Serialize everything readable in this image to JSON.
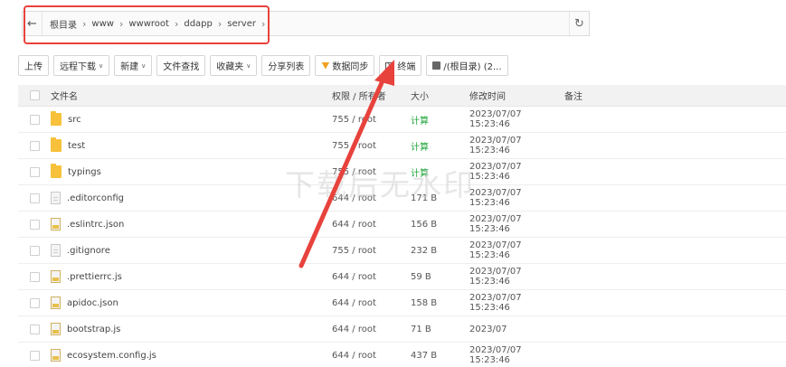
{
  "pathbar": {
    "crumbs": [
      "根目录",
      "www",
      "wwwroot",
      "ddapp",
      "server"
    ]
  },
  "toolbar": {
    "upload": "上传",
    "remote_download": "远程下载",
    "new": "新建",
    "file_search": "文件查找",
    "favorites": "收藏夹",
    "share_list": "分享列表",
    "data_sync": "数据同步",
    "terminal": "终端",
    "disk": "/(根目录) (2..."
  },
  "table": {
    "headers": {
      "name": "文件名",
      "perm": "权限 / 所有者",
      "size": "大小",
      "mtime": "修改时间",
      "note": "备注"
    },
    "rows": [
      {
        "name": "src",
        "perm": "755 / root",
        "size": "计算",
        "mtime": "2023/07/07 15:23:46"
      },
      {
        "name": "test",
        "perm": "755 / root",
        "size": "计算",
        "mtime": "2023/07/07 15:23:46"
      },
      {
        "name": "typings",
        "perm": "755 / root",
        "size": "计算",
        "mtime": "2023/07/07 15:23:46"
      },
      {
        "name": ".editorconfig",
        "perm": "644 / root",
        "size": "171 B",
        "mtime": "2023/07/07 15:23:46"
      },
      {
        "name": ".eslintrc.json",
        "perm": "644 / root",
        "size": "156 B",
        "mtime": "2023/07/07 15:23:46"
      },
      {
        "name": ".gitignore",
        "perm": "755 / root",
        "size": "232 B",
        "mtime": "2023/07/07 15:23:46"
      },
      {
        "name": ".prettierrc.js",
        "perm": "644 / root",
        "size": "59 B",
        "mtime": "2023/07/07 15:23:46"
      },
      {
        "name": "apidoc.json",
        "perm": "644 / root",
        "size": "158 B",
        "mtime": "2023/07/07 15:23:46"
      },
      {
        "name": "bootstrap.js",
        "perm": "644 / root",
        "size": "71 B",
        "mtime": "2023/07"
      },
      {
        "name": "ecosystem.config.js",
        "perm": "644 / root",
        "size": "437 B",
        "mtime": "2023/07/07 15:23:46"
      }
    ]
  },
  "watermark": "下载后无水印",
  "colors": {
    "highlight": "#e8423c",
    "calc_green": "#20a53a",
    "folder": "#f7c13b"
  }
}
